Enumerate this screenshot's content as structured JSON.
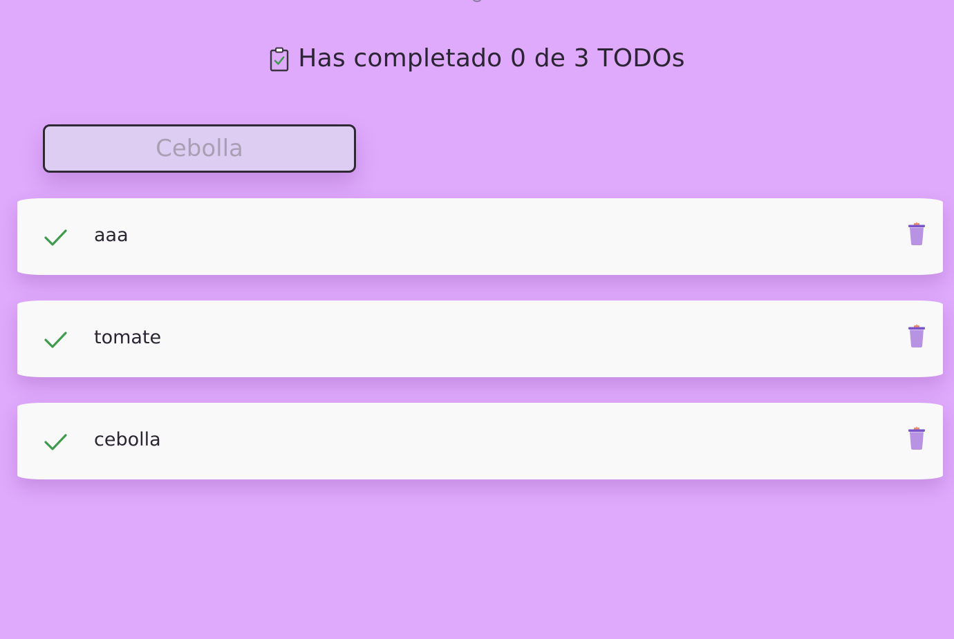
{
  "header": {
    "icon": "clipboard-check-icon",
    "title": "Has completado 0 de 3 TODOs"
  },
  "search": {
    "placeholder": "Cebolla",
    "value": ""
  },
  "todos": [
    {
      "text": "aaa",
      "completed": false
    },
    {
      "text": "tomate",
      "completed": false
    },
    {
      "text": "cebolla",
      "completed": false
    }
  ],
  "colors": {
    "background": "#dfa9fc",
    "check": "#3f9b4d",
    "trash_body": "#b993e3",
    "trash_lid": "#7a55c9",
    "trash_handle": "#f08c6e"
  }
}
